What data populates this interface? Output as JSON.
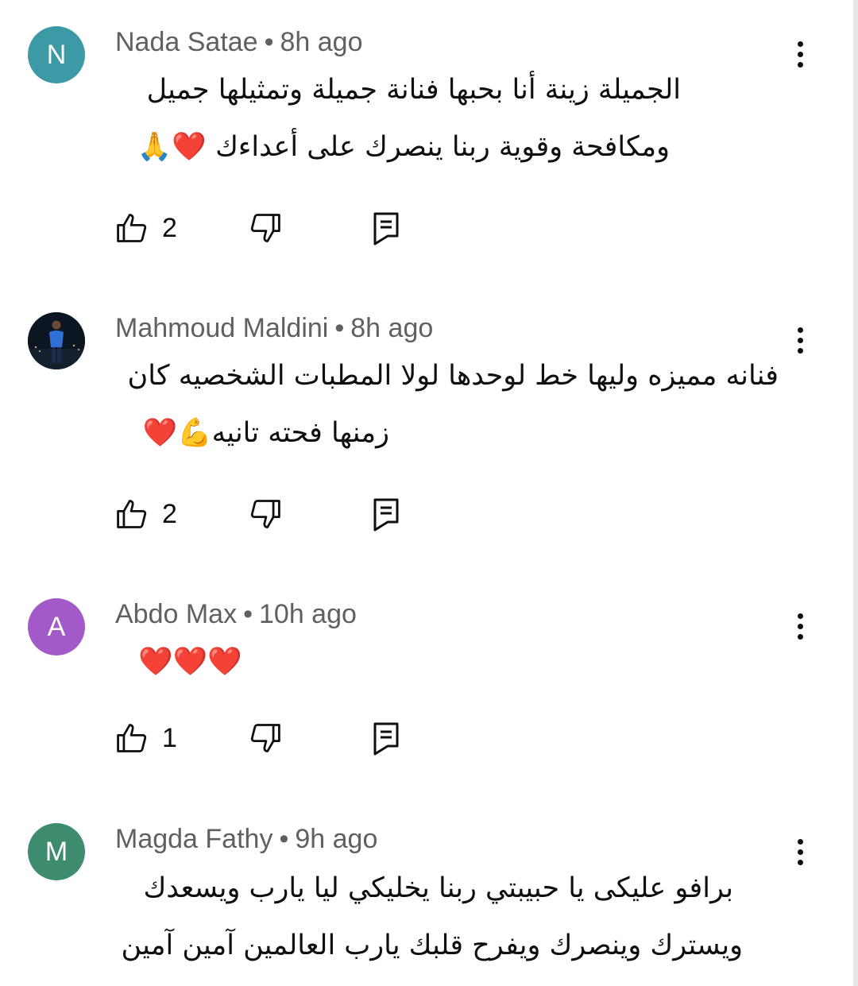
{
  "comments": [
    {
      "avatar_letter": "N",
      "avatar_color": "#3b9aa5",
      "author": "Nada Satae",
      "separator": "•",
      "time": "8h ago",
      "lines": [
        "الجميلة زينة أنا بحبها فنانة جميلة وتمثيلها جميل",
        "ومكافحة وقوية ربنا ينصرك على أعداءك ❤️🙏"
      ],
      "likes": "2"
    },
    {
      "avatar_letter": "",
      "avatar_color": "#0b1622",
      "author": "Mahmoud Maldini",
      "separator": "•",
      "time": "8h ago",
      "lines": [
        "فنانه مميزه وليها خط لوحدها لولا المطبات الشخصيه كان",
        "زمنها فحته تانيه💪❤️"
      ],
      "likes": "2"
    },
    {
      "avatar_letter": "A",
      "avatar_color": "#a35ac8",
      "author": "Abdo Max",
      "separator": "•",
      "time": "10h ago",
      "lines": [
        "❤️❤️❤️"
      ],
      "likes": "1"
    },
    {
      "avatar_letter": "M",
      "avatar_color": "#3e8c6e",
      "author": "Magda Fathy",
      "separator": "•",
      "time": "9h ago",
      "lines": [
        "برافو عليكى يا حبيبتي ربنا يخليكي ليا يارب ويسعدك",
        "ويسترك وينصرك ويفرح قلبك يارب العالمين آمين آمين"
      ]
    }
  ],
  "icons": {
    "like": "thumb-up-icon",
    "dislike": "thumb-down-icon",
    "reply": "reply-icon",
    "more": "more-vertical-icon"
  }
}
